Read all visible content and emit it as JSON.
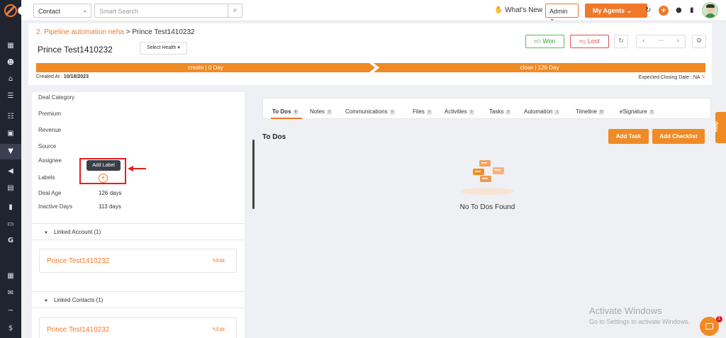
{
  "rail": {
    "icons": [
      "dashboard-icon",
      "contacts-icon",
      "accounts-icon",
      "list-icon",
      "contact-card-icon",
      "pipeline-icon",
      "megaphone-icon",
      "document-icon",
      "reports-icon",
      "folder-icon",
      "google-icon",
      "calendar-icon",
      "mail-icon",
      "signature-icon",
      "billing-icon"
    ]
  },
  "header": {
    "context_select": "Contact",
    "search_placeholder": "Smart Search",
    "whats_new": "What's New",
    "role_select": "Admin",
    "agents_button": "My Agents"
  },
  "deal": {
    "breadcrumb_link": "2. Pipeline automation neha",
    "breadcrumb_sep": " > ",
    "breadcrumb_current": "Prince Test1410232",
    "title": "Prince Test1410232",
    "health_select": "Select Health",
    "won_label": "Won",
    "lost_label": "Lost",
    "more_label": "···",
    "stages": [
      "create | 0 Day",
      "close | 126 Day"
    ],
    "created_label": "Created At : ",
    "created_value": "10/18/2023",
    "closing_label": "Expected Closing Date : NA"
  },
  "details": {
    "fields": [
      {
        "label": "Deal Category",
        "value": ""
      },
      {
        "label": "Premium",
        "value": ""
      },
      {
        "label": "Revenue",
        "value": ""
      },
      {
        "label": "Source",
        "value": ""
      },
      {
        "label": "Assignee",
        "value": ""
      },
      {
        "label": "Labels",
        "value": ""
      },
      {
        "label": "Deal Age",
        "value": "126 days"
      },
      {
        "label": "Inactive Days",
        "value": "113 days"
      }
    ],
    "tooltip": "Add Label",
    "linked_account_title": "Linked Account (1)",
    "linked_account_name": "Prince Test1410232",
    "linked_contacts_title": "Linked Contacts (1)",
    "linked_contact_name": "Prince Test1410232",
    "edit_label": "Edit"
  },
  "tabs": [
    {
      "label": "To Dos",
      "count": "0"
    },
    {
      "label": "Notes",
      "count": "0"
    },
    {
      "label": "Communications",
      "count": "0"
    },
    {
      "label": "Files",
      "count": "0"
    },
    {
      "label": "Activities",
      "count": "0"
    },
    {
      "label": "Tasks",
      "count": "0"
    },
    {
      "label": "Automation",
      "count": "1"
    },
    {
      "label": "Timeline",
      "count": "10"
    },
    {
      "label": "eSignature",
      "count": "0"
    }
  ],
  "todos": {
    "title": "To Dos",
    "add_task": "Add Task",
    "add_checklist": "Add Checklist",
    "empty": "No To Dos Found"
  },
  "watermark": {
    "line1": "Activate Windows",
    "line2": "Go to Settings to activate Windows."
  },
  "help_label": "Help",
  "chat_count": "1",
  "colors": {
    "accent": "#f0782a",
    "rail": "#1f2430",
    "won": "#5cb85c",
    "lost": "#d9534f",
    "annotation": "#e41e1e"
  }
}
